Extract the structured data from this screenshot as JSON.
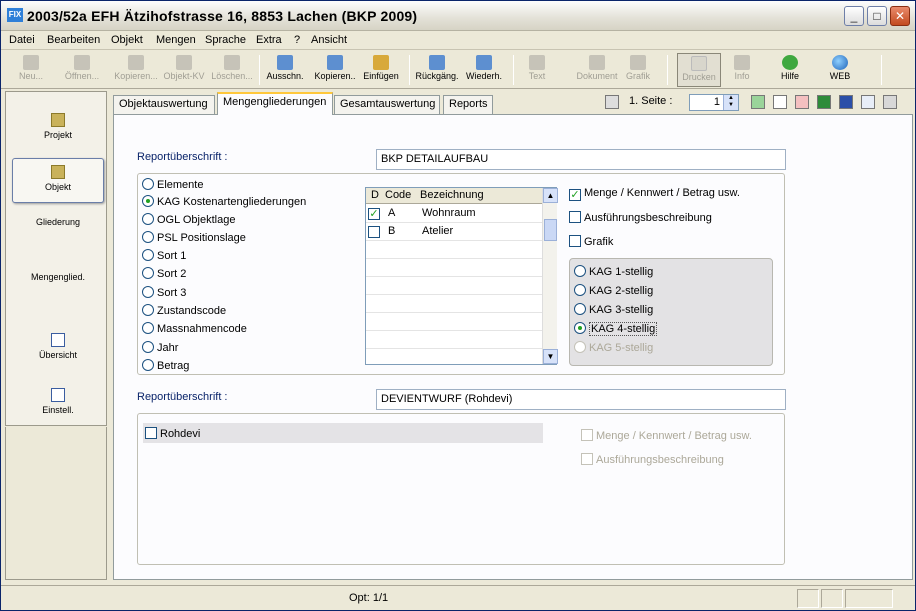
{
  "window": {
    "title": "2003/52a EFH Ätzihofstrasse 16, 8853 Lachen (BKP 2009)",
    "app_icon_text": "FIX"
  },
  "menu": [
    "Datei",
    "Bearbeiten",
    "Objekt",
    "Mengen",
    "Sprache",
    "Extra",
    "?",
    "Ansicht"
  ],
  "toolbar": {
    "neu": "Neu...",
    "oeffnen": "Öffnen...",
    "kopieren1": "Kopieren...",
    "objektkv": "Objekt-KV",
    "loeschen": "Löschen...",
    "ausschn": "Ausschn.",
    "kopieren2": "Kopieren..",
    "einfuegen": "Einfügen",
    "rueckgaeng": "Rückgäng.",
    "wiederh": "Wiederh.",
    "text": "Text",
    "dokument": "Dokument",
    "grafik": "Grafik",
    "drucken": "Drucken",
    "info": "Info",
    "hilfe": "Hilfe",
    "web": "WEB"
  },
  "sidebar": {
    "items": [
      "Projekt",
      "Objekt",
      "Gliederung",
      "Mengenglied.",
      "Übersicht",
      "Einstell."
    ]
  },
  "tabs": [
    "Objektauswertung",
    "Mengengliederungen",
    "Gesamtauswertung",
    "Reports"
  ],
  "page_control": {
    "label": "1. Seite :",
    "value": "1"
  },
  "section1": {
    "label": "Reportüberschrift :",
    "value": "BKP DETAILAUFBAU",
    "radios": [
      "Elemente",
      "KAG Kostenartengliederungen",
      "OGL Objektlage",
      "PSL Positionslage",
      "Sort 1",
      "Sort 2",
      "Sort 3",
      "Zustandscode",
      "Massnahmencode",
      "Jahr",
      "Betrag"
    ],
    "selected_radio": "KAG Kostenartengliederungen",
    "grid": {
      "headers": [
        "D",
        "Code",
        "Bezeichnung"
      ],
      "rows": [
        {
          "checked": true,
          "code": "A",
          "name": "Wohnraum"
        },
        {
          "checked": false,
          "code": "B",
          "name": "Atelier"
        }
      ]
    },
    "checks": [
      {
        "label": "Menge / Kennwert / Betrag usw.",
        "checked": true
      },
      {
        "label": "Ausführungsbeschreibung",
        "checked": false
      },
      {
        "label": "Grafik",
        "checked": false
      }
    ],
    "kag": [
      "KAG 1-stellig",
      "KAG 2-stellig",
      "KAG 3-stellig",
      "KAG 4-stellig",
      "KAG 5-stellig"
    ],
    "kag_selected": "KAG 4-stellig"
  },
  "section2": {
    "label": "Reportüberschrift :",
    "value": "DEVIENTWURF (Rohdevi)",
    "rohdevi": "Rohdevi",
    "checks": [
      "Menge / Kennwert / Betrag usw.",
      "Ausführungsbeschreibung"
    ]
  },
  "status": {
    "text": "Opt: 1/1"
  }
}
